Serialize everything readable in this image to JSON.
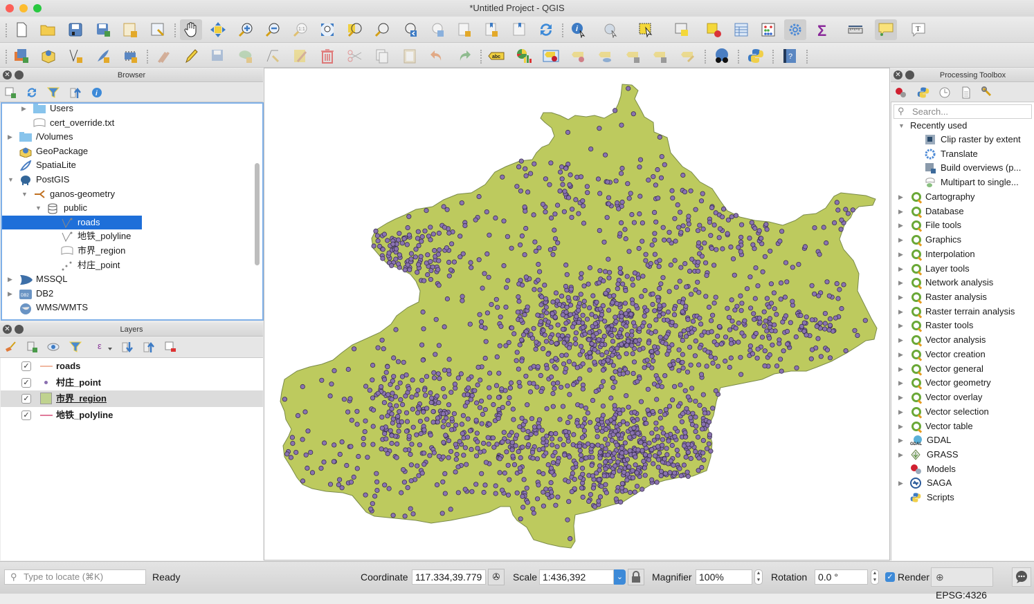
{
  "window": {
    "title": "*Untitled Project - QGIS"
  },
  "toolbar1": {
    "items": [
      "new-project",
      "open-project",
      "save-project",
      "save-as",
      "new-print-layout",
      "layout-manager",
      "pan",
      "pan-to-selection",
      "zoom-in",
      "zoom-out",
      "zoom-native",
      "zoom-full",
      "zoom-to-selection",
      "zoom-to-layer",
      "zoom-last",
      "zoom-next",
      "new-bookmark",
      "new-spatial-bookmark",
      "show-bookmarks",
      "refresh",
      "identify",
      "run-feature-action",
      "select-features",
      "select-by-value",
      "deselect-all",
      "attribute-table",
      "field-calculator",
      "processing-toolbox",
      "statistical-summary",
      "measure",
      "map-tips",
      "text-annotation"
    ]
  },
  "toolbar2": {
    "items": [
      "data-source-manager",
      "new-geopackage-layer",
      "new-shapefile-layer",
      "new-spatialite-layer",
      "new-virtual-layer",
      "current-edits",
      "toggle-editing",
      "save-layer-edits",
      "add-polygon-feature",
      "vertex-tool",
      "modify-attributes",
      "delete-selected",
      "cut-features",
      "copy-features",
      "paste-features",
      "undo",
      "redo",
      "layer-labeling",
      "layer-diagram",
      "highlight-pinned-labels",
      "pin-labels",
      "show-hide-labels",
      "move-label",
      "rotate-label",
      "change-label",
      "metasearch",
      "python-console",
      "help"
    ]
  },
  "browser": {
    "title": "Browser",
    "tree": [
      {
        "label": "Users",
        "indent": 2,
        "arrow": "right",
        "icon": "folder"
      },
      {
        "label": "cert_override.txt",
        "indent": 2,
        "arrow": "",
        "icon": "file"
      },
      {
        "label": "/Volumes",
        "indent": 1,
        "arrow": "right",
        "icon": "folder"
      },
      {
        "label": "GeoPackage",
        "indent": 1,
        "arrow": "",
        "icon": "geopackage"
      },
      {
        "label": "SpatiaLite",
        "indent": 1,
        "arrow": "",
        "icon": "spatialite"
      },
      {
        "label": "PostGIS",
        "indent": 1,
        "arrow": "down",
        "icon": "postgis"
      },
      {
        "label": "ganos-geometry",
        "indent": 2,
        "arrow": "down",
        "icon": "connection"
      },
      {
        "label": "public",
        "indent": 3,
        "arrow": "down",
        "icon": "schema"
      },
      {
        "label": "roads",
        "indent": 4,
        "arrow": "",
        "icon": "line-layer",
        "selected": true
      },
      {
        "label": "地铁_polyline",
        "indent": 4,
        "arrow": "",
        "icon": "line-layer"
      },
      {
        "label": "市界_region",
        "indent": 4,
        "arrow": "",
        "icon": "polygon-layer"
      },
      {
        "label": "村庄_point",
        "indent": 4,
        "arrow": "",
        "icon": "point-layer"
      },
      {
        "label": "MSSQL",
        "indent": 1,
        "arrow": "right",
        "icon": "mssql"
      },
      {
        "label": "DB2",
        "indent": 1,
        "arrow": "right",
        "icon": "db2"
      },
      {
        "label": "WMS/WMTS",
        "indent": 1,
        "arrow": "",
        "icon": "wms"
      }
    ]
  },
  "layers": {
    "title": "Layers",
    "items": [
      {
        "label": "roads",
        "checked": true,
        "symbol": "line",
        "color": "#f0b8a0",
        "highlighted": false
      },
      {
        "label": "村庄_point",
        "checked": true,
        "symbol": "point",
        "color": "#8a6fb0",
        "highlighted": false
      },
      {
        "label": "市界_region",
        "checked": true,
        "symbol": "fill",
        "color": "#bfd28f",
        "highlighted": true
      },
      {
        "label": "地铁_polyline",
        "checked": true,
        "symbol": "line",
        "color": "#e07a9a",
        "highlighted": false
      }
    ]
  },
  "processing": {
    "title": "Processing Toolbox",
    "search_placeholder": "Search...",
    "recently_used_label": "Recently used",
    "recent": [
      "Clip raster by extent",
      "Translate",
      "Build overviews (p...",
      "Multipart to single..."
    ],
    "groups": [
      {
        "label": "Cartography",
        "icon": "qgis"
      },
      {
        "label": "Database",
        "icon": "qgis"
      },
      {
        "label": "File tools",
        "icon": "qgis"
      },
      {
        "label": "Graphics",
        "icon": "qgis"
      },
      {
        "label": "Interpolation",
        "icon": "qgis"
      },
      {
        "label": "Layer tools",
        "icon": "qgis"
      },
      {
        "label": "Network analysis",
        "icon": "qgis"
      },
      {
        "label": "Raster analysis",
        "icon": "qgis"
      },
      {
        "label": "Raster terrain analysis",
        "icon": "qgis"
      },
      {
        "label": "Raster tools",
        "icon": "qgis"
      },
      {
        "label": "Vector analysis",
        "icon": "qgis"
      },
      {
        "label": "Vector creation",
        "icon": "qgis"
      },
      {
        "label": "Vector general",
        "icon": "qgis"
      },
      {
        "label": "Vector geometry",
        "icon": "qgis"
      },
      {
        "label": "Vector overlay",
        "icon": "qgis"
      },
      {
        "label": "Vector selection",
        "icon": "qgis"
      },
      {
        "label": "Vector table",
        "icon": "qgis"
      },
      {
        "label": "GDAL",
        "icon": "gdal"
      },
      {
        "label": "GRASS",
        "icon": "grass"
      },
      {
        "label": "Models",
        "icon": "models",
        "noarrow": true
      },
      {
        "label": "SAGA",
        "icon": "saga"
      },
      {
        "label": "Scripts",
        "icon": "python",
        "noarrow": true
      }
    ]
  },
  "map": {
    "region_fill": "#bdca5e",
    "region_stroke": "#7a8a4a",
    "point_fill": "#8a73b0",
    "point_stroke": "#3a3050"
  },
  "status": {
    "locate_placeholder": "Type to locate (⌘K)",
    "message": "Ready",
    "coordinate_label": "Coordinate",
    "coordinate_value": "117.334,39.779",
    "scale_label": "Scale",
    "scale_value": "1:436,392",
    "magnifier_label": "Magnifier",
    "magnifier_value": "100%",
    "rotation_label": "Rotation",
    "rotation_value": "0.0 °",
    "render_label": "Render",
    "render_checked": true,
    "crs": "EPSG:4326"
  }
}
